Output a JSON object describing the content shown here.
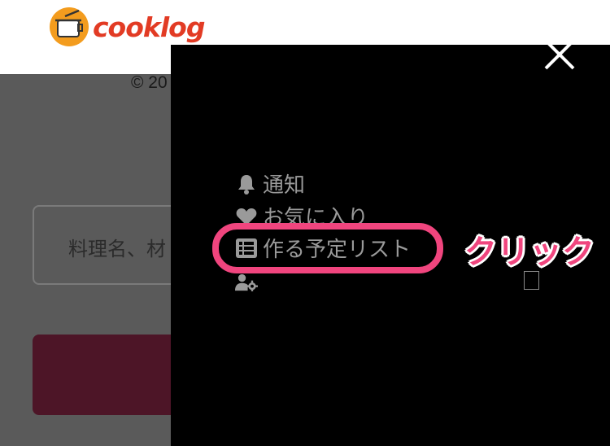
{
  "header": {
    "logo_text": "cooklog"
  },
  "background_page": {
    "copyright": "© 20",
    "search_placeholder": "料理名、材"
  },
  "menu": {
    "items": [
      {
        "icon": "bell-icon",
        "label": "通知"
      },
      {
        "icon": "heart-icon",
        "label": "お気に入り"
      },
      {
        "icon": "list-icon",
        "label": "作る予定リスト"
      },
      {
        "icon": "user-settings-icon",
        "label": ""
      }
    ]
  },
  "annotation": {
    "text": "クリック"
  },
  "colors": {
    "highlight": "#f0457e",
    "logo": "#e23b24",
    "button": "#4d1527"
  }
}
